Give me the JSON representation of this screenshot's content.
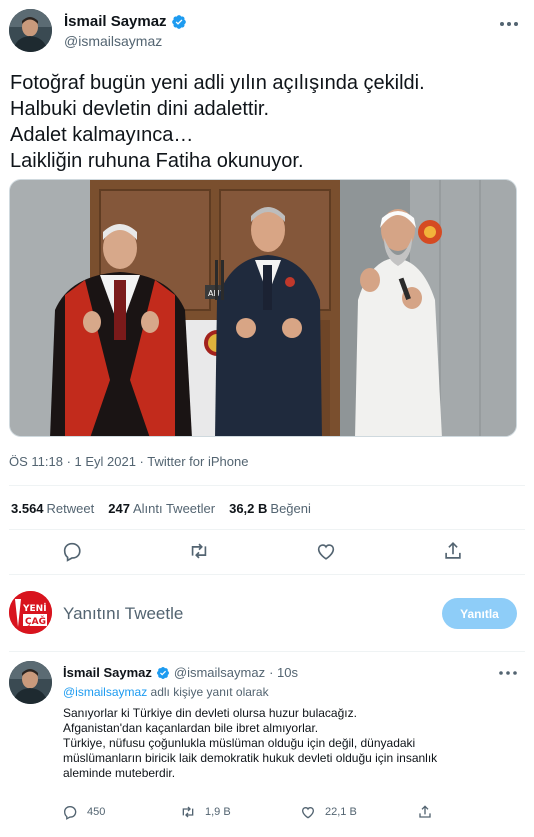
{
  "tweet": {
    "author_name": "İsmail Saymaz",
    "author_handle": "@ismailsaymaz",
    "lines": [
      "Fotoğraf bugün yeni adli yılın açılışında çekildi.",
      "Halbuki devletin dini adalettir.",
      "Adalet kalmayınca…",
      "Laikliğin ruhuna Fatiha okunuyor."
    ],
    "photo_sign": "ANKA",
    "meta": "ÖS 11:18 · 1 Eyl 2021 · Twitter for iPhone",
    "stats": [
      {
        "value": "3.564",
        "label": "Retweet"
      },
      {
        "value": "247",
        "label": "Alıntı Tweetler"
      },
      {
        "value": "36,2 B",
        "label": "Beğeni"
      }
    ]
  },
  "reply_box": {
    "avatar_text_1": "YENİ",
    "avatar_text_2": "ÇAĞ",
    "placeholder": "Yanıtını Tweetle",
    "button_label": "Yanıtla"
  },
  "reply": {
    "author_name": "İsmail Saymaz",
    "author_handle": "@ismailsaymaz",
    "time": "· 10s",
    "reply_to_mention": "@ismailsaymaz",
    "reply_to_suffix": " adlı kişiye yanıt olarak",
    "lines": [
      "Sanıyorlar ki Türkiye din devleti olursa huzur bulacağız.",
      "Afganistan'dan kaçanlardan bile ibret almıyorlar.",
      "Türkiye, nüfusu çoğunlukla müslüman olduğu için değil, dünyadaki",
      "müslümanların biricik laik demokratik hukuk devleti olduğu için insanlık",
      "aleminde muteberdir."
    ],
    "reply_count": "450",
    "retweet_count": "1,9 B",
    "like_count": "22,1 B"
  },
  "colors": {
    "accent": "#1d9bf0",
    "reply_button": "#8ecdf8",
    "yeni_cag_red": "#d8141e",
    "secondary_text": "#536471"
  },
  "icons": [
    "verified-badge-icon",
    "more-icon",
    "reply-icon",
    "retweet-icon",
    "like-icon",
    "share-icon"
  ]
}
